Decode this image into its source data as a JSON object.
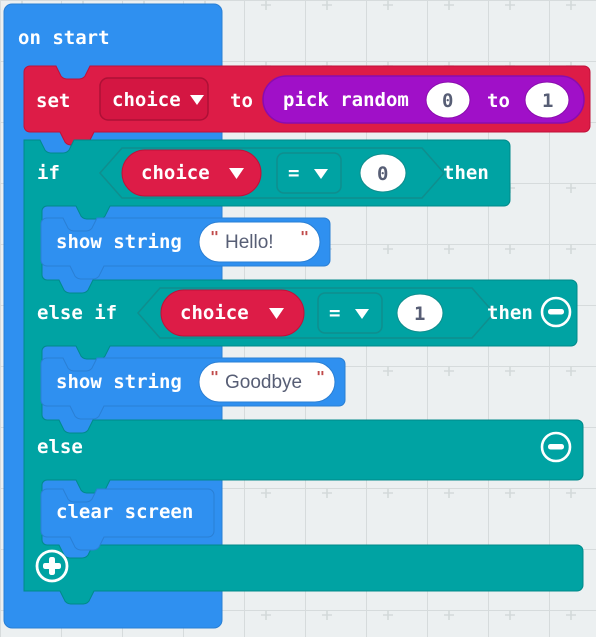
{
  "editor": {
    "name": "makecode-block-editor",
    "canvas_background": "#ecf0f1",
    "grid_dot_color": "#d6dbdc"
  },
  "palette": {
    "event_blue": "#2f90f0",
    "variable_red": "#dd1c47",
    "variable_red_dark": "#c8163d",
    "logic_teal": "#00a3a3",
    "logic_teal_dark": "#00807f",
    "math_purple": "#a010c8",
    "basic_blue": "#2f90f0",
    "field_white": "#ffffff",
    "field_text": "#575E75",
    "quote_color": "#c04a4a"
  },
  "blocks": {
    "on_start": {
      "label": "on start",
      "color": "#2f90f0"
    },
    "set_variable": {
      "keyword": "set",
      "variable": "choice",
      "to_label": "to",
      "dropdown_icon": "chevron-down-icon",
      "color": "#dd1c47"
    },
    "pick_random": {
      "label": "pick random",
      "min": "0",
      "to_label": "to",
      "max": "1",
      "color": "#a010c8"
    },
    "if_clause": {
      "keyword": "if",
      "variable": "choice",
      "operator": "=",
      "operand": "0",
      "then_label": "then",
      "color": "#00a3a3"
    },
    "show_string_1": {
      "keyword": "show string",
      "open_quote": "\"",
      "value": "Hello!",
      "close_quote": "\"",
      "color": "#2f90f0"
    },
    "else_if_clause": {
      "keyword": "else if",
      "variable": "choice",
      "operator": "=",
      "operand": "1",
      "then_label": "then",
      "remove_icon": "minus-circle-icon",
      "color": "#00a3a3"
    },
    "show_string_2": {
      "keyword": "show string",
      "open_quote": "\"",
      "value": "Goodbye",
      "close_quote": "\"",
      "color": "#2f90f0"
    },
    "else_clause": {
      "keyword": "else",
      "remove_icon": "minus-circle-icon",
      "color": "#00a3a3"
    },
    "clear_screen": {
      "label": "clear screen",
      "color": "#2f90f0"
    },
    "add_clause": {
      "add_icon": "plus-circle-icon",
      "color": "#00a3a3"
    }
  }
}
